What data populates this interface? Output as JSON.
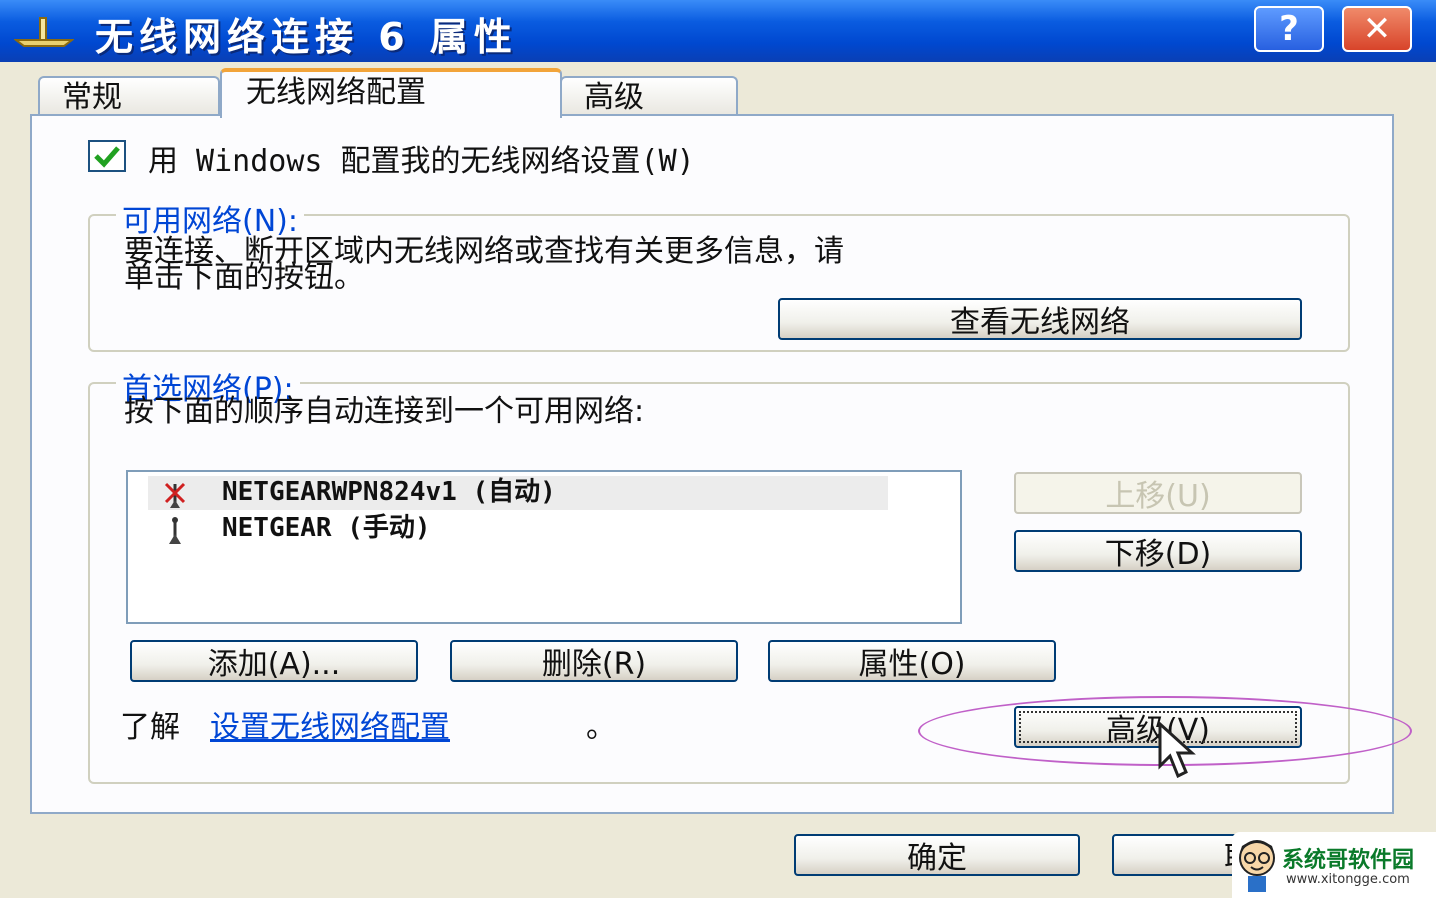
{
  "window": {
    "title": "无线网络连接 6 属性",
    "help_label": "?",
    "close_label": "✕"
  },
  "tabs": [
    {
      "label": "常规"
    },
    {
      "label": "无线网络配置",
      "selected": true
    },
    {
      "label": "高级"
    }
  ],
  "checkbox": {
    "label": "用 Windows 配置我的无线网络设置(W)",
    "checked": true
  },
  "available": {
    "legend": "可用网络(N):",
    "desc_line1": "要连接、断开区域内无线网络或查找有关更多信息，请",
    "desc_line2": "单击下面的按钮。",
    "view_button": "查看无线网络"
  },
  "preferred": {
    "legend": "首选网络(P):",
    "desc": "按下面的顺序自动连接到一个可用网络:",
    "networks": [
      {
        "name": "NETGEARWPN824v1 (自动)",
        "icon": "wireless-antenna-disconnected-icon"
      },
      {
        "name": "NETGEAR (手动)",
        "icon": "wireless-antenna-icon"
      }
    ],
    "move_up": "上移(U)",
    "move_down": "下移(D)",
    "add": "添加(A)...",
    "remove": "删除(R)",
    "properties": "属性(O)",
    "learn_prefix": "了解",
    "learn_link": "设置无线网络配置",
    "learn_suffix": "。",
    "advanced": "高级(V)"
  },
  "footer": {
    "ok": "确定",
    "cancel": "取"
  },
  "watermark": {
    "title": "系统哥软件园",
    "url": "www.xitongge.com"
  },
  "colors": {
    "titlebar": "#0a5ce0",
    "link": "#0046d5",
    "tab_accent": "#f2a43a",
    "highlight": "#c060c8"
  }
}
